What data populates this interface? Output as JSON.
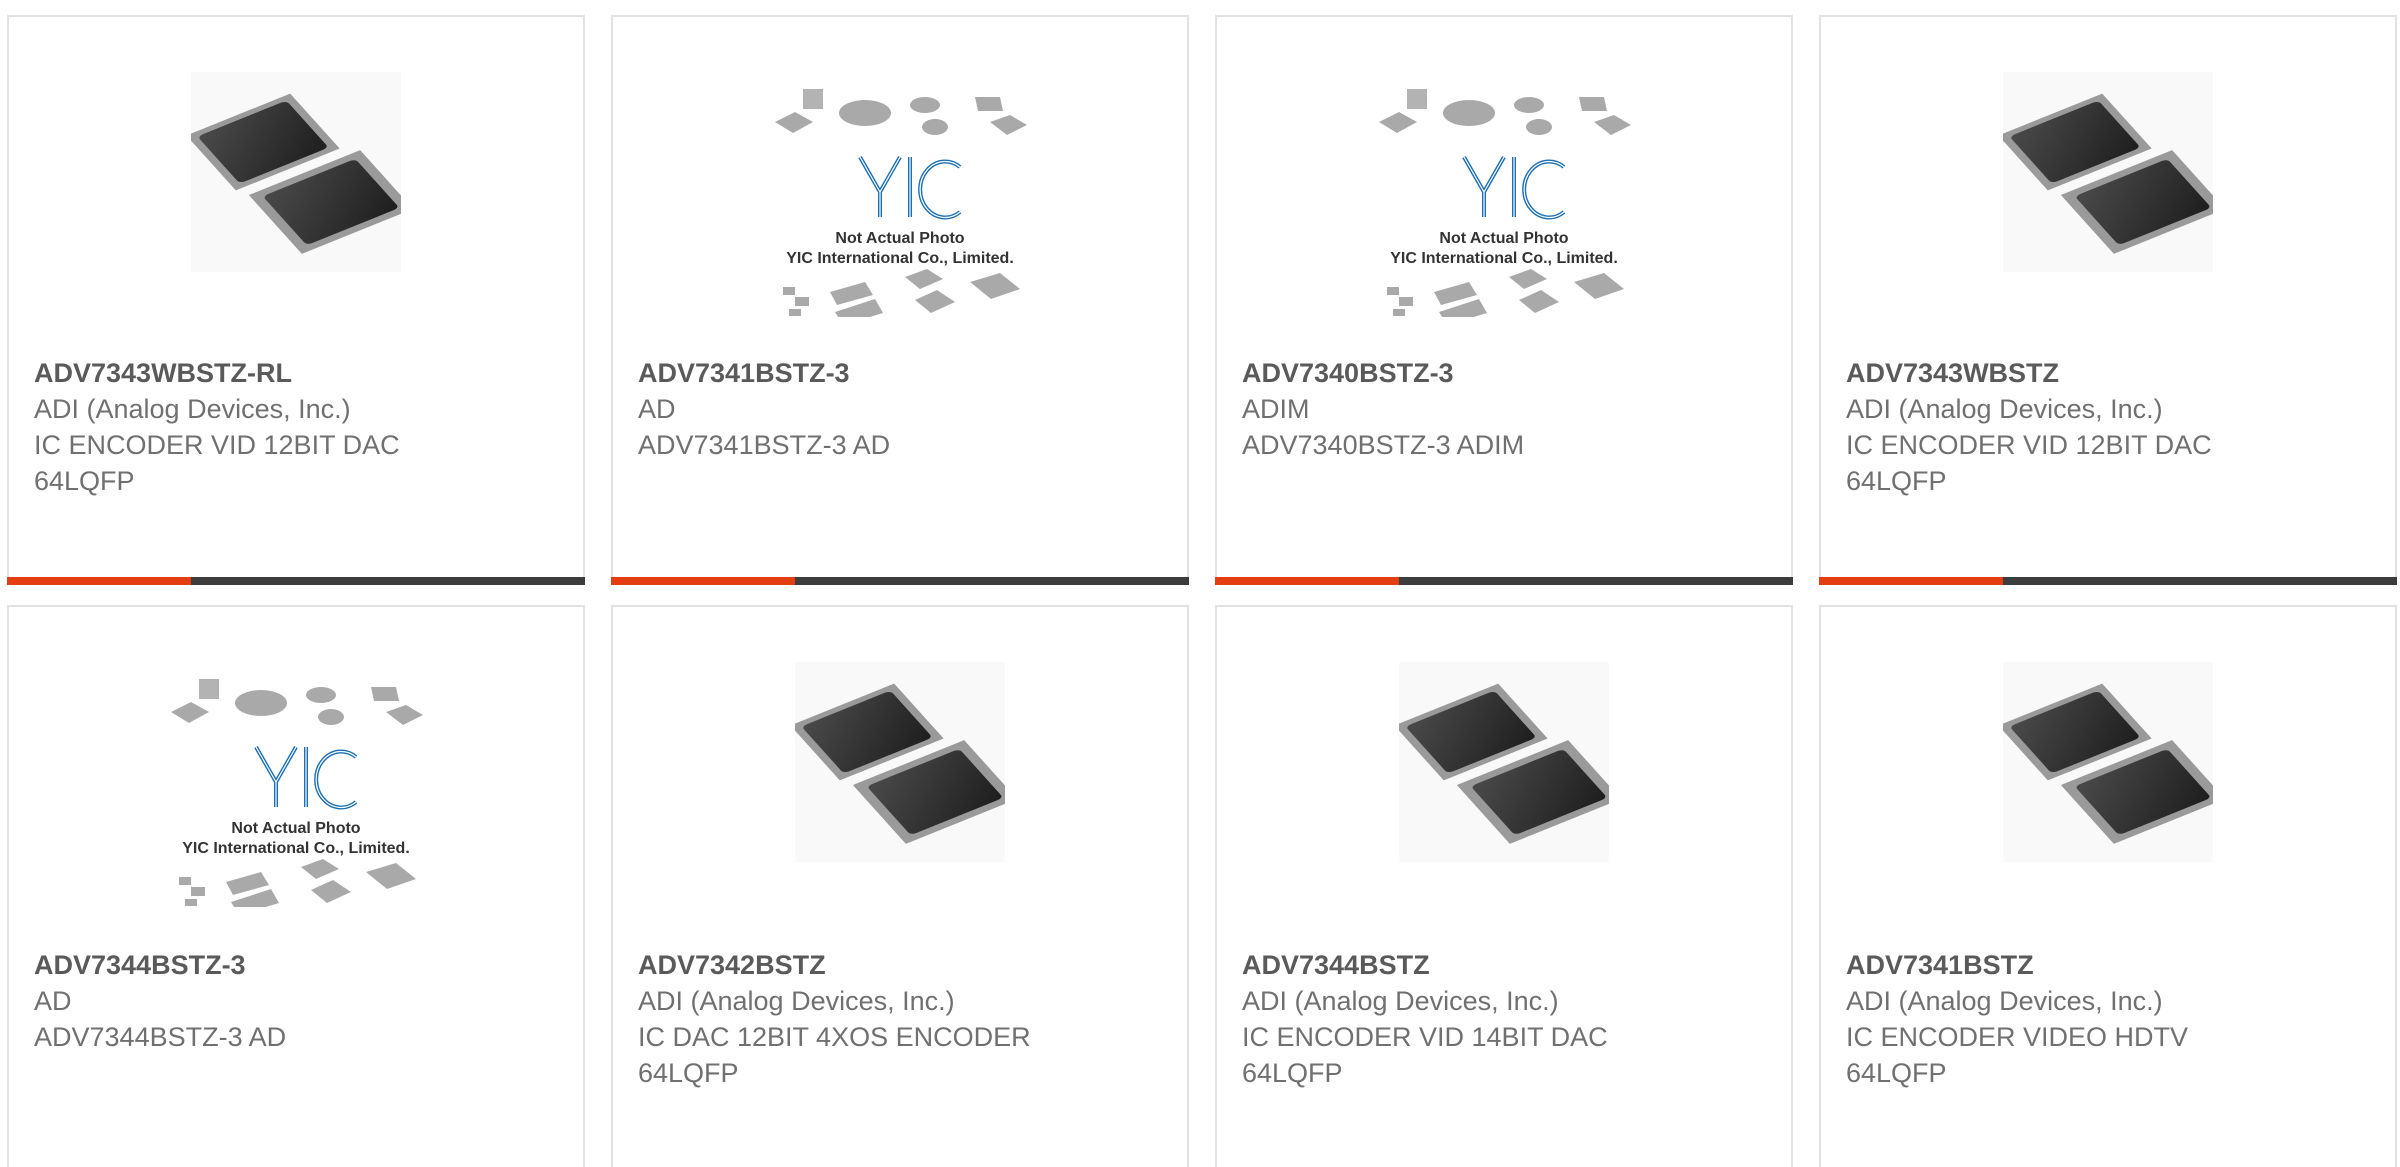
{
  "colors": {
    "accent": "#e43d11",
    "bar": "#3c3c3c",
    "title": "#5a5a5a",
    "text": "#707070"
  },
  "placeholder": {
    "line1": "Not Actual Photo",
    "line2": "YIC International Co., Limited.",
    "logo": "YIC"
  },
  "products": [
    {
      "part": "ADV7343WBSTZ-RL",
      "mfr": "ADI (Analog Devices, Inc.)",
      "desc1": "IC ENCODER VID 12BIT DAC",
      "desc2": "64LQFP",
      "image": "chip-photo"
    },
    {
      "part": "ADV7341BSTZ-3",
      "mfr": "AD",
      "desc1": "ADV7341BSTZ-3 AD",
      "desc2": "",
      "image": "yic-placeholder"
    },
    {
      "part": "ADV7340BSTZ-3",
      "mfr": "ADIM",
      "desc1": "ADV7340BSTZ-3 ADIM",
      "desc2": "",
      "image": "yic-placeholder"
    },
    {
      "part": "ADV7343WBSTZ",
      "mfr": "ADI (Analog Devices, Inc.)",
      "desc1": "IC ENCODER VID 12BIT DAC",
      "desc2": "64LQFP",
      "image": "chip-photo"
    },
    {
      "part": "ADV7344BSTZ-3",
      "mfr": "AD",
      "desc1": "ADV7344BSTZ-3 AD",
      "desc2": "",
      "image": "yic-placeholder"
    },
    {
      "part": "ADV7342BSTZ",
      "mfr": "ADI (Analog Devices, Inc.)",
      "desc1": "IC DAC 12BIT 4XOS ENCODER",
      "desc2": "64LQFP",
      "image": "chip-photo"
    },
    {
      "part": "ADV7344BSTZ",
      "mfr": "ADI (Analog Devices, Inc.)",
      "desc1": "IC ENCODER VID 14BIT DAC",
      "desc2": "64LQFP",
      "image": "chip-photo"
    },
    {
      "part": "ADV7341BSTZ",
      "mfr": "ADI (Analog Devices, Inc.)",
      "desc1": "IC ENCODER VIDEO HDTV",
      "desc2": "64LQFP",
      "image": "chip-photo"
    }
  ]
}
